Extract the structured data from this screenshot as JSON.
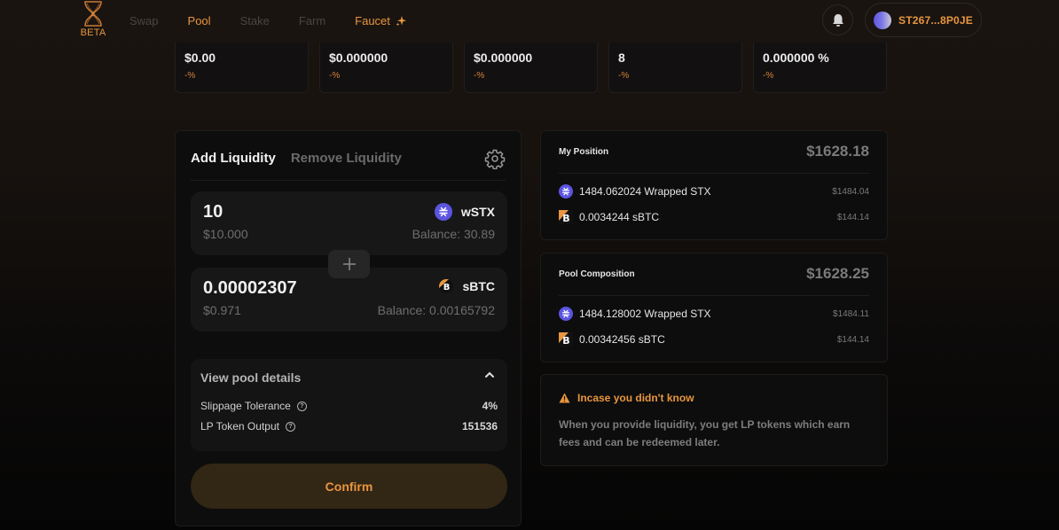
{
  "header": {
    "logo_label": "BETA",
    "nav": [
      {
        "label": "Swap",
        "active": false
      },
      {
        "label": "Pool",
        "active": true
      },
      {
        "label": "Stake",
        "active": false
      },
      {
        "label": "Farm",
        "active": false
      }
    ],
    "faucet_label": "Faucet",
    "wallet_address": "ST267...8P0JE",
    "icons": {
      "notifications": "bell-icon",
      "faucet": "sparkle-icon"
    }
  },
  "stats": [
    {
      "value": "$0.00",
      "change": "-%"
    },
    {
      "value": "$0.000000",
      "change": "-%"
    },
    {
      "value": "$0.000000",
      "change": "-%"
    },
    {
      "value": "8",
      "change": "-%"
    },
    {
      "value": "0.000000 %",
      "change": "-%"
    }
  ],
  "liquidity": {
    "tabs": [
      {
        "label": "Add Liquidity",
        "active": true
      },
      {
        "label": "Remove Liquidity",
        "active": false
      }
    ],
    "token_a": {
      "amount": "10",
      "usd": "$10.000",
      "symbol": "wSTX",
      "balance": "Balance: 30.89"
    },
    "token_b": {
      "amount": "0.00002307",
      "usd": "$0.971",
      "symbol": "sBTC",
      "balance": "Balance: 0.00165792"
    },
    "details": {
      "title": "View pool details",
      "expanded": true,
      "rows": [
        {
          "label": "Slippage Tolerance",
          "value": "4%"
        },
        {
          "label": "LP Token Output",
          "value": "151536"
        }
      ]
    },
    "confirm_label": "Confirm"
  },
  "my_position": {
    "title": "My Position",
    "total": "$1628.18",
    "assets": [
      {
        "amount": "1484.062024 Wrapped STX",
        "usd": "$1484.04",
        "icon": "stx-icon"
      },
      {
        "amount": "0.0034244 sBTC",
        "usd": "$144.14",
        "icon": "sbtc-icon"
      }
    ]
  },
  "pool_composition": {
    "title": "Pool Composition",
    "total": "$1628.25",
    "assets": [
      {
        "amount": "1484.128002 Wrapped STX",
        "usd": "$1484.11",
        "icon": "stx-icon"
      },
      {
        "amount": "0.00342456 sBTC",
        "usd": "$144.14",
        "icon": "sbtc-icon"
      }
    ]
  },
  "info": {
    "title": "Incase you didn't know",
    "text": "When you provide liquidity, you get LP tokens which earn fees and can be redeemed later."
  },
  "colors": {
    "accent": "#e8963f",
    "stx": "#5b55e0",
    "confirm_bg": "#322614"
  }
}
